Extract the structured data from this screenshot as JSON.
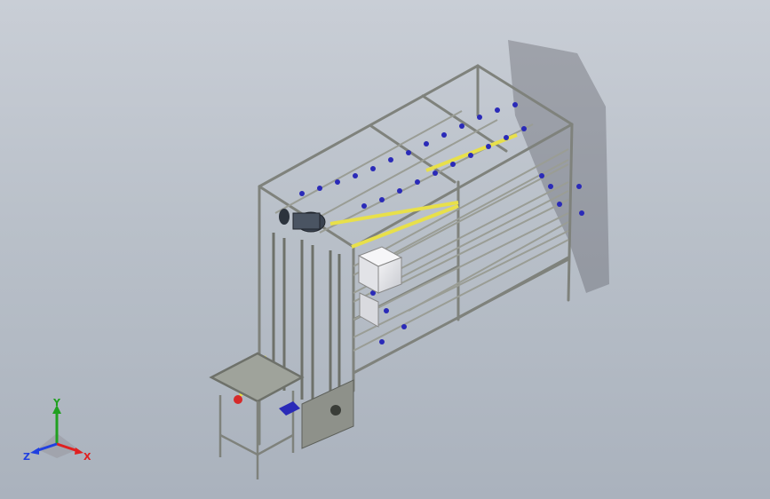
{
  "triad": {
    "x_label": "X",
    "y_label": "Y",
    "z_label": "Z",
    "x_color": "#e02020",
    "y_color": "#20a020",
    "z_color": "#2040e0"
  },
  "scene": {
    "background_top": "#c9ced6",
    "background_bottom": "#aab2bd",
    "frame_color": "#8a8c86",
    "accent_yellow": "#e8e04a",
    "accent_blue": "#2a2ab8",
    "motor_color": "#3a4350",
    "red_part": "#d62a2a"
  }
}
